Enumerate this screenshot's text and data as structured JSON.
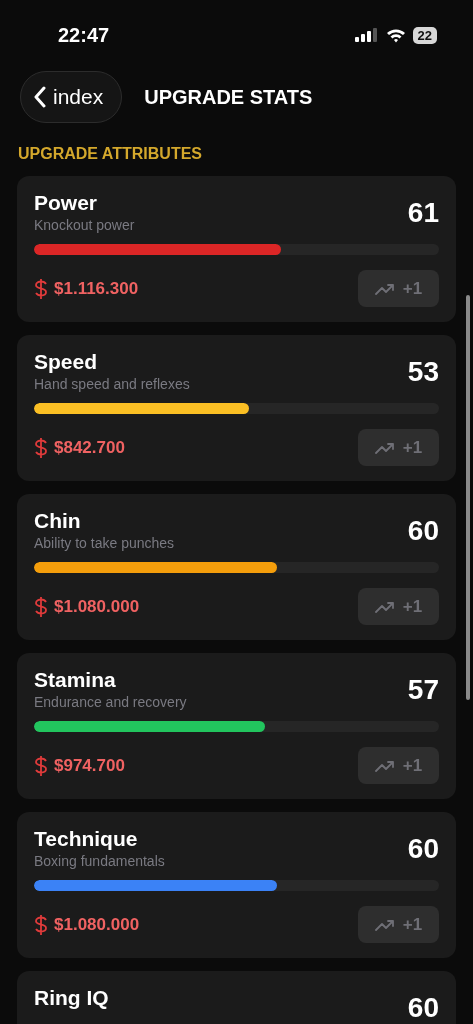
{
  "status_bar": {
    "time": "22:47",
    "battery": "22"
  },
  "header": {
    "back_label": "index",
    "title": "UPGRADE STATS"
  },
  "section_title": "UPGRADE ATTRIBUTES",
  "attributes": [
    {
      "name": "Power",
      "description": "Knockout power",
      "value": "61",
      "level": 0.61,
      "color": "#dc2626",
      "price": "$1.116.300",
      "button_label": "+1",
      "disabled": true
    },
    {
      "name": "Speed",
      "description": "Hand speed and reflexes",
      "value": "53",
      "level": 0.53,
      "color": "#fbbf24",
      "price": "$842.700",
      "button_label": "+1",
      "disabled": true
    },
    {
      "name": "Chin",
      "description": "Ability to take punches",
      "value": "60",
      "level": 0.6,
      "color": "#f59e0b",
      "price": "$1.080.000",
      "button_label": "+1",
      "disabled": true
    },
    {
      "name": "Stamina",
      "description": "Endurance and recovery",
      "value": "57",
      "level": 0.57,
      "color": "#22c55e",
      "price": "$974.700",
      "button_label": "+1",
      "disabled": true
    },
    {
      "name": "Technique",
      "description": "Boxing fundamentals",
      "value": "60",
      "level": 0.6,
      "color": "#3b82f6",
      "price": "$1.080.000",
      "button_label": "+1",
      "disabled": true
    },
    {
      "name": "Ring IQ",
      "value": "60"
    }
  ]
}
